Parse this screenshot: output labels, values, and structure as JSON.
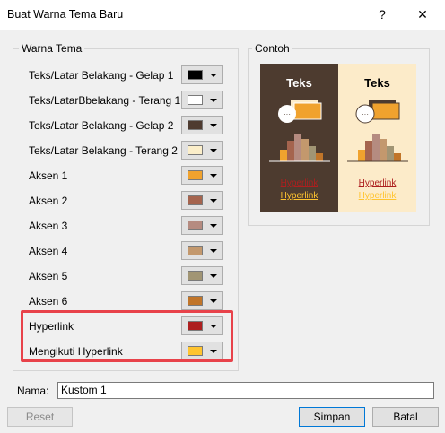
{
  "window": {
    "title": "Buat Warna Tema Baru",
    "help": "?",
    "close": "✕"
  },
  "theme_group": {
    "legend": "Warna Tema",
    "rows": [
      {
        "label": "Teks/Latar Belakang - Gelap 1",
        "color": "#000000"
      },
      {
        "label": "Teks/LatarBbelakang - Terang 1",
        "color": "#ffffff"
      },
      {
        "label": "Teks/Latar Belakang - Gelap 2",
        "color": "#4e3b30"
      },
      {
        "label": "Teks/Latar Belakang - Terang 2",
        "color": "#fbeec9"
      },
      {
        "label": "Aksen 1",
        "color": "#f0a22e"
      },
      {
        "label": "Aksen 2",
        "color": "#a5644e"
      },
      {
        "label": "Aksen 3",
        "color": "#b58b80"
      },
      {
        "label": "Aksen 4",
        "color": "#c3986d"
      },
      {
        "label": "Aksen 5",
        "color": "#a19574"
      },
      {
        "label": "Aksen 6",
        "color": "#c17529"
      },
      {
        "label": "Hyperlink",
        "color": "#ad1f1f"
      },
      {
        "label": "Mengikuti Hyperlink",
        "color": "#ffc42f"
      }
    ]
  },
  "sample_group": {
    "legend": "Contoh",
    "dark": {
      "title": "Teks",
      "link": "Hyperlink",
      "followed": "Hyperlink"
    },
    "light": {
      "title": "Teks",
      "link": "Hyperlink",
      "followed": "Hyperlink"
    }
  },
  "name_field": {
    "label": "Nama:",
    "value": "Kustom 1"
  },
  "buttons": {
    "reset": "Reset",
    "save": "Simpan",
    "cancel": "Batal"
  }
}
